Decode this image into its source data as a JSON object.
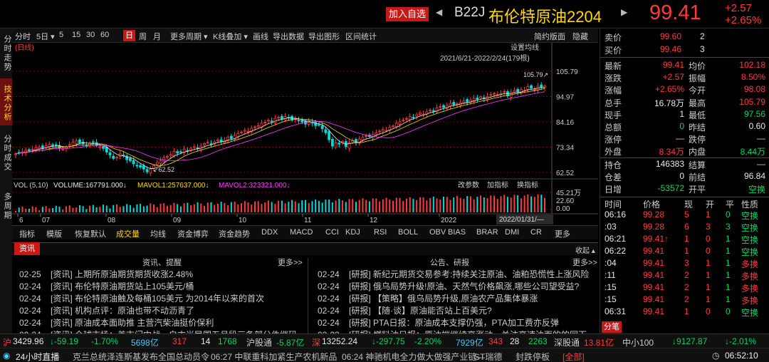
{
  "header": {
    "add_label": "加入自选",
    "left_arrow": "◀",
    "right_arrow": "▶",
    "code": "B22J",
    "name": "布伦特原油2204",
    "price": "99.41",
    "change": "+2.57",
    "change_pct": "+2.65%"
  },
  "vtabs": [
    "分时走势",
    "技术分析",
    "分时成交",
    "多周期"
  ],
  "toolbar": {
    "items": [
      "分时",
      "5日 ▾",
      "5",
      "15",
      "30",
      "60",
      "日",
      "周",
      "月",
      "更多周期 ▾",
      "K线叠加 ▾",
      "画线",
      "导出数据",
      "导出图形",
      "区间统计"
    ],
    "right": [
      "简约版面",
      "隐藏"
    ],
    "selected": "日"
  },
  "chart_labels": {
    "fq": "(日线)",
    "ma_setting": "设置均线",
    "range": "2021/6/21-2022/2/24(179根)",
    "high_label": "105.79↗",
    "low_label": "↙62.52",
    "vol_legend_label": "VOL (5,10)",
    "volume": "VOLUME:167791.000↓",
    "mavol1": "MAVOL1:257637.000↓",
    "mavol2": "MAVOL2:323321.000↓",
    "vol_btns": [
      "改参数",
      "加指标",
      "换指标"
    ],
    "cursor_date": "2022/01/31/—"
  },
  "chart_data": {
    "type": "candlestick",
    "title": "",
    "x_ticks": [
      "6",
      "07",
      "08",
      "09",
      "10",
      "11",
      "12",
      "2022"
    ],
    "y_ticks": [
      105.79,
      94.97,
      84.16,
      73.34,
      62.52
    ],
    "vol_ticks": [
      "45.21万",
      "22.60",
      "0.00"
    ],
    "ylim": [
      62.52,
      105.79
    ],
    "closes": [
      70.5,
      71,
      71.4,
      72,
      71.8,
      72.5,
      73,
      73.4,
      72.8,
      73.9,
      74.5,
      73.8,
      74.2,
      73,
      72.5,
      73.5,
      74.5,
      75.4,
      76,
      75.2,
      74.8,
      74.1,
      75,
      75.3,
      74,
      73.5,
      72.8,
      71.2,
      70,
      68.5,
      69,
      70.5,
      69.8,
      68,
      67.5,
      66.2,
      65.5,
      64.8,
      64,
      62.8,
      64,
      65.5,
      66.8,
      67.5,
      68.8,
      69.4,
      70.2,
      71.5,
      70.8,
      71.2,
      72.5,
      71.8,
      72.9,
      73.5,
      72.6,
      73.8,
      74.9,
      75.4,
      74.8,
      75.5,
      76.5,
      75.8,
      76.2,
      77.5,
      77,
      78.4,
      79.2,
      79.8,
      80.5,
      80.1,
      81.4,
      82,
      82.5,
      83.6,
      84,
      84.8,
      84.2,
      85.6,
      86.1,
      85.5,
      86.4,
      86,
      84.9,
      85.5,
      84.8,
      84,
      83.2,
      84.5,
      83.6,
      82.5,
      82.9,
      81.2,
      79.5,
      76.5,
      73.8,
      75.2,
      74.6,
      75.8,
      73.5,
      75.2,
      76.1,
      75.4,
      76.8,
      77.5,
      78.2,
      77.8,
      78.9,
      79.5,
      80.2,
      81,
      80.5,
      81.8,
      82.4,
      83.6,
      84.2,
      84.9,
      85.6,
      86.4,
      86,
      87.2,
      88,
      87.5,
      88.4,
      89.2,
      88.9,
      90.1,
      90.7,
      90.3,
      91.2,
      92,
      91.5,
      91.9,
      92.4,
      93.1,
      92.6,
      93.5,
      94.2,
      93.8,
      94.9,
      94.1,
      95,
      95.8,
      96.3,
      95.9,
      96.2,
      97.1,
      95.3,
      96.8,
      97.5,
      96.9,
      98,
      97.6,
      99.3,
      98.5,
      98.1,
      99.4,
      98.8,
      99.41
    ]
  },
  "indicator_tabs": [
    "指标",
    "模版",
    "恢复默认",
    "成交量",
    "均线",
    "资金博弈",
    "资金趋势",
    "DDX",
    "MACD",
    "CCI",
    "KDJ",
    "RSI",
    "BOLL",
    "OBV",
    "BIAS",
    "BRAR",
    "DMI",
    "CR",
    "更多"
  ],
  "news": {
    "tag": "资讯",
    "collapse": "收起 ▴",
    "left_title": "资讯、提醒",
    "right_title": "公告、研报",
    "more": "更多>>",
    "left": [
      {
        "d": "02-25",
        "t": "[资讯] 上期所原油期货期货收涨2.48%"
      },
      {
        "d": "02-24",
        "t": "[资讯] 布伦特原油期货站上105美元/桶"
      },
      {
        "d": "02-24",
        "t": "[资讯] 布伦特原油触及每桶105美元 为2014年以来的首次"
      },
      {
        "d": "02-24",
        "t": "[资讯] 机构点评：原油也带不动沥青了"
      },
      {
        "d": "02-24",
        "t": "[资讯] 原油成本面助推 主营汽柴油挺价保利"
      },
      {
        "d": "02-24",
        "t": "[资讯] 全球市场：美市门中战，自古当民国五月段三条部分件继码"
      }
    ],
    "right": [
      {
        "d": "02-24",
        "t": "[研报] 新纪元期货交易参考:持续关注原油、油粕恐慌性上涨风险"
      },
      {
        "d": "02-24",
        "t": "[研报] 俄乌局势升级!原油、天然气价格飙涨,哪些公司望受益?"
      },
      {
        "d": "02-24",
        "t": "[研报] 【策略】俄乌局势升级,原油农产品集体暴涨"
      },
      {
        "d": "02-24",
        "t": "[研报] 【随·谈】原油能否站上百美元?"
      },
      {
        "d": "02-24",
        "t": "[研报] PTA日报：原油成本支撑仍强，PTA加工费亦反弹"
      },
      {
        "d": "02-23",
        "t": "[研报] 燃料油日报：原油端继续高涨动，关注高速油面的的同下"
      }
    ]
  },
  "quote": {
    "sell": [
      "卖价",
      "99.60",
      "2"
    ],
    "buy": [
      "买价",
      "99.46",
      "3"
    ],
    "rows": [
      [
        "最新",
        "99.41",
        "均价",
        "102.18"
      ],
      [
        "涨跌",
        "+2.57",
        "振幅",
        "8.50%"
      ],
      [
        "涨幅",
        "+2.65%",
        "今开",
        "98.08"
      ],
      [
        "总手",
        "16.78万",
        "最高",
        "105.79"
      ],
      [
        "现手",
        "1",
        "最低",
        "97.56"
      ],
      [
        "总额",
        "0",
        "昨结",
        "0.60"
      ],
      [
        "涨停",
        "—",
        "跌停",
        "—"
      ],
      [
        "外盘",
        "8.34万",
        "内盘",
        "8.44万"
      ]
    ],
    "rows2": [
      [
        "持仓",
        "146383",
        "结算",
        "—"
      ],
      [
        "仓差",
        "0",
        "前结",
        "96.84"
      ],
      [
        "日增",
        "-53572",
        "开平",
        "空换"
      ]
    ]
  },
  "ticks": {
    "head": [
      "时间",
      "价格",
      "现",
      "开",
      "平",
      "性质"
    ],
    "rows": [
      [
        "06:16",
        "99.28",
        "5",
        "1",
        "0",
        "空换"
      ],
      [
        ":03",
        "99.28",
        "6",
        "3",
        "3",
        "空换"
      ],
      [
        "06:21",
        "99.41↑",
        "1",
        "0",
        "1",
        "空换"
      ],
      [
        "06:22",
        "99.41",
        "1",
        "0",
        "1",
        "空换"
      ],
      [
        ":04",
        "99.41",
        "3",
        "1",
        "1",
        "多换"
      ],
      [
        ":11",
        "99.41",
        "2",
        "1",
        "1",
        "多换"
      ],
      [
        ":15",
        "99.41",
        "2",
        "1",
        "1",
        "多换"
      ],
      [
        ":15",
        "99.41",
        "2",
        "1",
        "1",
        "多换"
      ],
      [
        "06:31",
        "99.41",
        "1",
        "0",
        "0",
        "空换"
      ]
    ],
    "tag": "分笔"
  },
  "footer": {
    "row1": [
      [
        "沪",
        "3429.96",
        "↓-59.19",
        "-1.70%",
        "5698亿",
        "317",
        "14",
        "1768"
      ],
      [
        "沪股通",
        "-5.87亿"
      ],
      [
        "深",
        "13252.24",
        "↓-297.75",
        "-2.20%",
        "7929亿",
        "343",
        "28",
        "2263"
      ],
      [
        "深股通",
        "13.81亿"
      ],
      [
        "中小100",
        "↓9127.87",
        "↓-2.01%"
      ]
    ],
    "live": "24小时直播",
    "ticker": [
      "克兰总统泽连斯基发布全国总动员令",
      "06:27 中联重科加紧生产农机新品",
      "06:24 神驰机电全力做大做强产业链—",
      "ST瑞德",
      "封跌停板",
      "[全部]"
    ],
    "clock": "06:52:10"
  }
}
